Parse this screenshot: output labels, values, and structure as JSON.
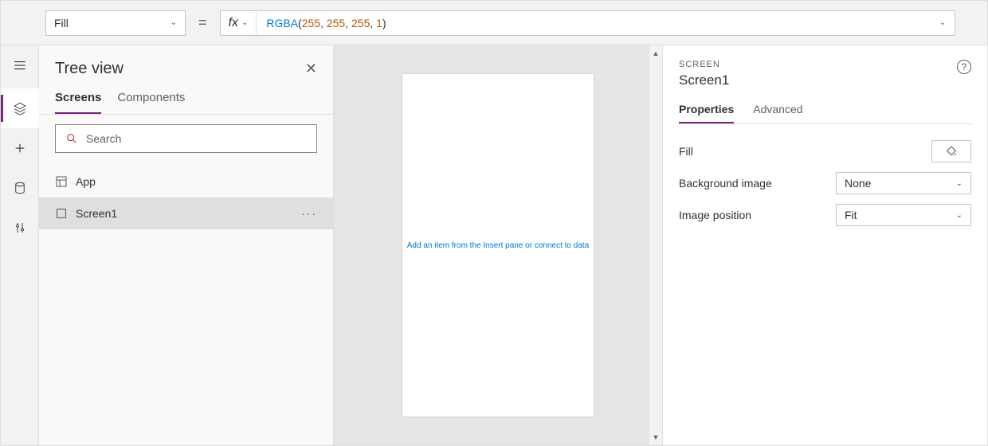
{
  "formula_bar": {
    "property": "Fill",
    "fx_label": "fx",
    "equals": "=",
    "formula_fn": "RGBA",
    "formula_args": [
      "255",
      "255",
      "255",
      "1"
    ]
  },
  "tree": {
    "title": "Tree view",
    "tabs": {
      "screens": "Screens",
      "components": "Components"
    },
    "search_placeholder": "Search",
    "items": [
      {
        "label": "App"
      },
      {
        "label": "Screen1"
      }
    ]
  },
  "canvas": {
    "hint": "Add an item from the Insert pane or connect to data"
  },
  "props": {
    "type_label": "SCREEN",
    "name": "Screen1",
    "tabs": {
      "properties": "Properties",
      "advanced": "Advanced"
    },
    "rows": {
      "fill": "Fill",
      "bg_image": {
        "label": "Background image",
        "value": "None"
      },
      "image_pos": {
        "label": "Image position",
        "value": "Fit"
      }
    }
  }
}
